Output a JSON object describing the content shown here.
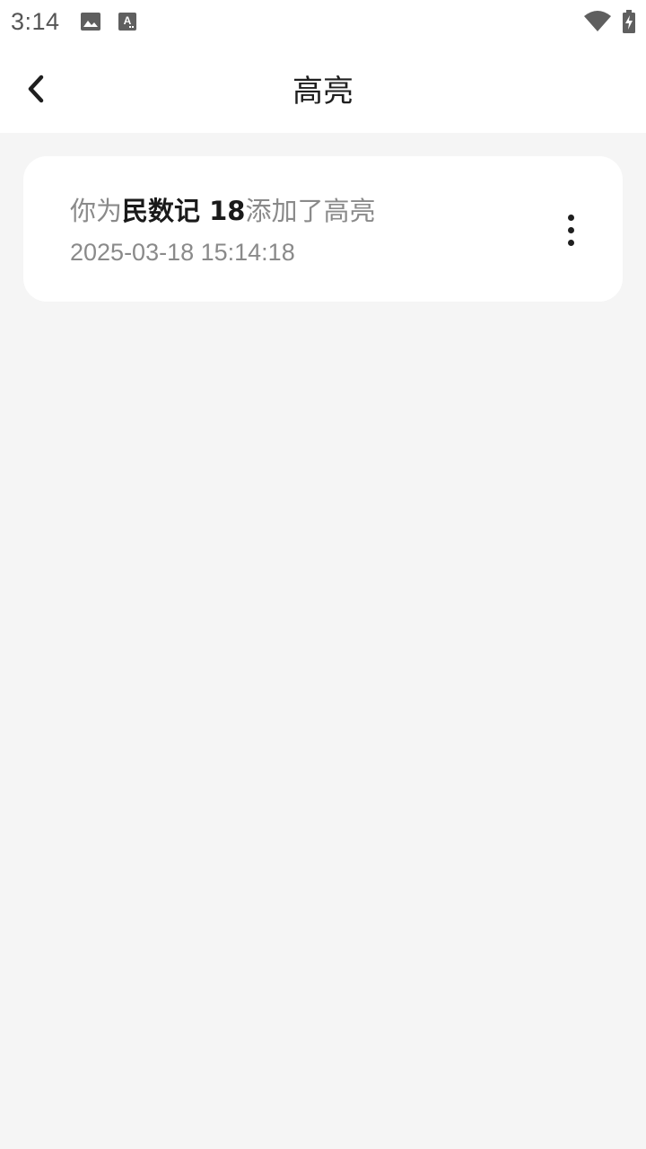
{
  "status_bar": {
    "time": "3:14",
    "icons": [
      "image-icon",
      "text-recognition-icon",
      "wifi-icon",
      "battery-charging-icon"
    ]
  },
  "app_bar": {
    "title": "高亮",
    "back_icon": "chevron-left-icon"
  },
  "activity": {
    "items": [
      {
        "prefix": "你为",
        "subject": "民数记 18",
        "suffix": "添加了高亮",
        "timestamp": "2025-03-18 15:14:18",
        "menu_icon": "more-vertical-icon"
      }
    ]
  },
  "colors": {
    "background": "#f5f5f5",
    "surface": "#ffffff",
    "text_primary": "#1f1f1f",
    "text_secondary": "#8a8a8a"
  }
}
